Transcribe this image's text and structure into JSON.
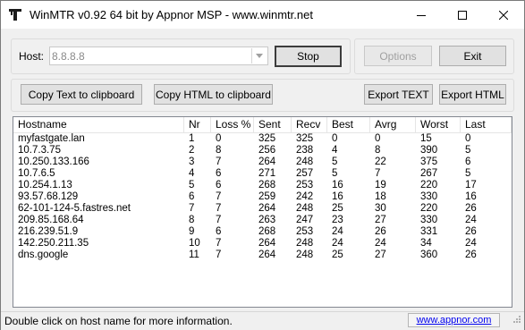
{
  "window": {
    "title": "WinMTR v0.92 64 bit by Appnor MSP - www.winmtr.net"
  },
  "host": {
    "label": "Host:",
    "value": "8.8.8.8"
  },
  "buttons": {
    "stop": "Stop",
    "options": "Options",
    "exit": "Exit",
    "copy_text": "Copy Text to clipboard",
    "copy_html": "Copy HTML to clipboard",
    "export_text": "Export TEXT",
    "export_html": "Export HTML"
  },
  "table": {
    "headers": [
      "Hostname",
      "Nr",
      "Loss %",
      "Sent",
      "Recv",
      "Best",
      "Avrg",
      "Worst",
      "Last"
    ],
    "rows": [
      [
        "myfastgate.lan",
        "1",
        "0",
        "325",
        "325",
        "0",
        "0",
        "15",
        "0"
      ],
      [
        "10.7.3.75",
        "2",
        "8",
        "256",
        "238",
        "4",
        "8",
        "390",
        "5"
      ],
      [
        "10.250.133.166",
        "3",
        "7",
        "264",
        "248",
        "5",
        "22",
        "375",
        "6"
      ],
      [
        "10.7.6.5",
        "4",
        "6",
        "271",
        "257",
        "5",
        "7",
        "267",
        "5"
      ],
      [
        "10.254.1.13",
        "5",
        "6",
        "268",
        "253",
        "16",
        "19",
        "220",
        "17"
      ],
      [
        "93.57.68.129",
        "6",
        "7",
        "259",
        "242",
        "16",
        "18",
        "330",
        "16"
      ],
      [
        "62-101-124-5.fastres.net",
        "7",
        "7",
        "264",
        "248",
        "25",
        "30",
        "220",
        "26"
      ],
      [
        "209.85.168.64",
        "8",
        "7",
        "263",
        "247",
        "23",
        "27",
        "330",
        "24"
      ],
      [
        "216.239.51.9",
        "9",
        "6",
        "268",
        "253",
        "24",
        "26",
        "331",
        "26"
      ],
      [
        "142.250.211.35",
        "10",
        "7",
        "264",
        "248",
        "24",
        "24",
        "34",
        "24"
      ],
      [
        "dns.google",
        "11",
        "7",
        "264",
        "248",
        "25",
        "27",
        "360",
        "26"
      ]
    ]
  },
  "status": {
    "text": "Double click on host name for more information.",
    "link": "www.appnor.com"
  },
  "colors": {
    "link": "#0000ee",
    "disabled_text": "#a0a0a0"
  }
}
